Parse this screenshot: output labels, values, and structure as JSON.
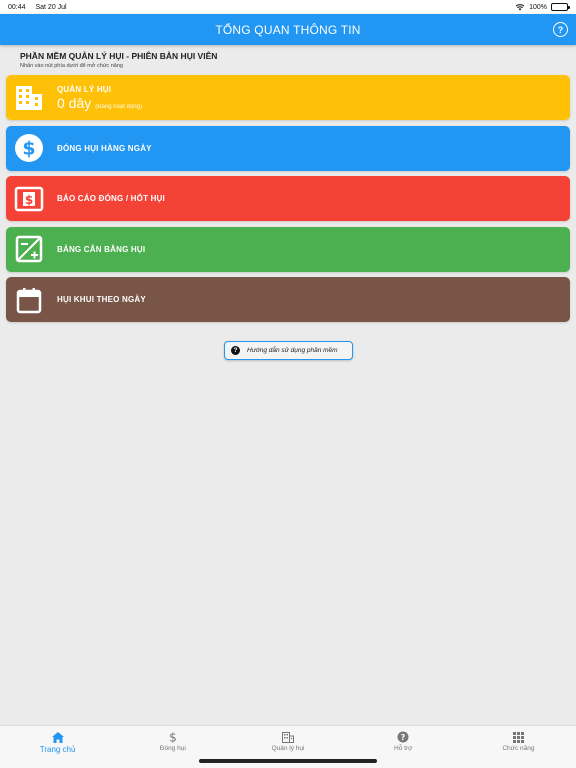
{
  "status_bar": {
    "time": "00:44",
    "date": "Sat 20 Jul",
    "battery": "100%"
  },
  "header": {
    "title": "TỔNG QUAN THÔNG TIN"
  },
  "intro": {
    "title": "PHẦN MỀM QUẢN LÝ HỤI - PHIÊN BẢN HỤI VIÊN",
    "subtitle": "Nhấn vào nút phía dưới để mở chức năng"
  },
  "cards": [
    {
      "label": "QUẢN LÝ HỤI",
      "count": "0 dây",
      "count_note": "(Đang hoạt động)",
      "color": "#ffc107",
      "icon": "building-icon"
    },
    {
      "label": "ĐÓNG HỤI HÀNG NGÀY",
      "color": "#2196f3",
      "icon": "dollar-circle-icon"
    },
    {
      "label": "BÁO CÁO ĐÓNG / HỐT HỤI",
      "color": "#f44336",
      "icon": "dollar-box-icon"
    },
    {
      "label": "BẢNG CÂN BẰNG HỤI",
      "color": "#4caf50",
      "icon": "plus-minus-box-icon"
    },
    {
      "label": "HỤI KHUI THEO NGÀY",
      "color": "#795548",
      "icon": "calendar-icon"
    }
  ],
  "guide_button": {
    "label": "Hướng dẫn sử dụng phần mềm"
  },
  "bottom_nav": [
    {
      "label": "Trang chủ",
      "icon": "home-icon",
      "active": true
    },
    {
      "label": "Đóng hụi",
      "icon": "dollar-icon"
    },
    {
      "label": "Quản lý hụi",
      "icon": "building-icon"
    },
    {
      "label": "Hỗ trợ",
      "icon": "help-circle-icon"
    },
    {
      "label": "Chức năng",
      "icon": "grid-icon"
    }
  ],
  "colors": {
    "primary": "#2196f3",
    "background": "#ebebeb"
  }
}
